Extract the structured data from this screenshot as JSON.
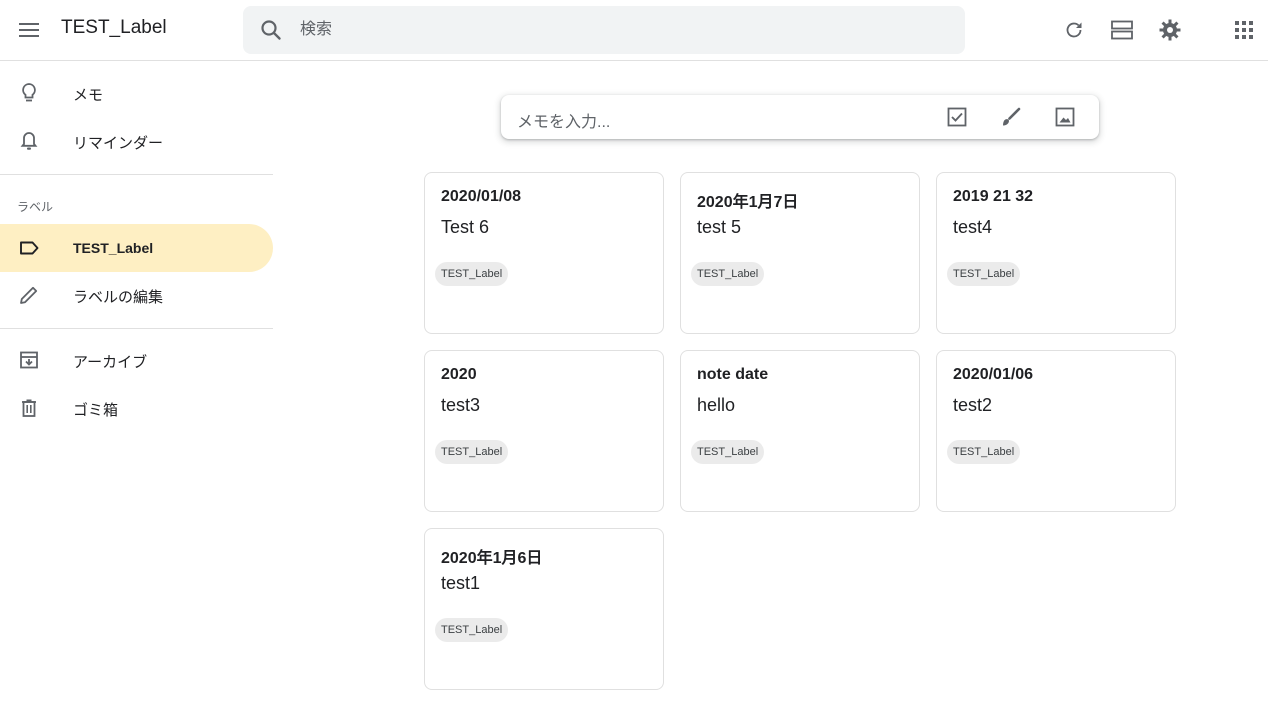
{
  "header": {
    "title": "TEST_Label",
    "search_placeholder": "検索"
  },
  "sidebar": {
    "items": [
      {
        "label": "メモ",
        "icon": "lightbulb-icon"
      },
      {
        "label": "リマインダー",
        "icon": "bell-icon"
      }
    ],
    "section_label": "ラベル",
    "labels": [
      {
        "label": "TEST_Label",
        "icon": "label-icon",
        "active": true
      },
      {
        "label": "ラベルの編集",
        "icon": "pencil-icon"
      }
    ],
    "bottom": [
      {
        "label": "アーカイブ",
        "icon": "archive-icon"
      },
      {
        "label": "ゴミ箱",
        "icon": "trash-icon"
      }
    ]
  },
  "take_note": {
    "placeholder": "メモを入力..."
  },
  "notes": [
    {
      "title": "2020/01/08",
      "body": "Test 6",
      "label": "TEST_Label"
    },
    {
      "title": "2020年1月7日",
      "body": "test 5",
      "label": "TEST_Label"
    },
    {
      "title": "2019 21 32",
      "body": "test4",
      "label": "TEST_Label"
    },
    {
      "title": "2020",
      "body": "test3",
      "label": "TEST_Label"
    },
    {
      "title": "note date",
      "body": "hello",
      "label": "TEST_Label"
    },
    {
      "title": "2020/01/06",
      "body": "test2",
      "label": "TEST_Label"
    },
    {
      "title": "2020年1月6日",
      "body": "test1",
      "label": "TEST_Label"
    }
  ],
  "colors": {
    "active_label_bg": "#feefc3",
    "search_bg": "#f1f3f4",
    "chip_bg": "#ebebeb"
  }
}
